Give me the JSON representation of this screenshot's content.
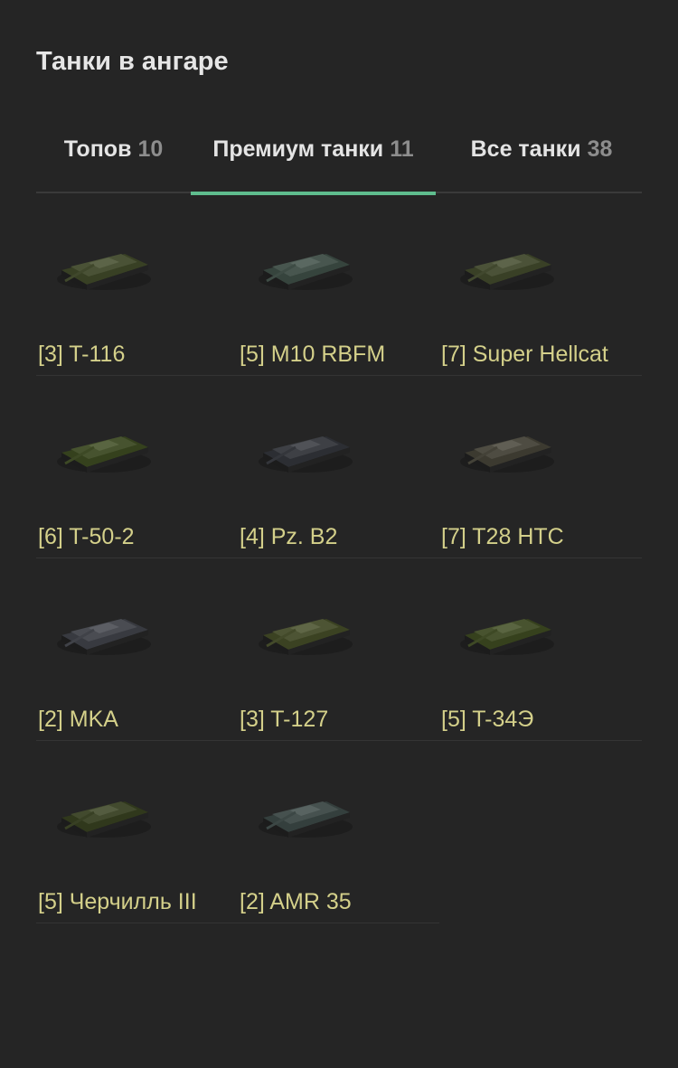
{
  "page": {
    "title": "Танки в ангаре"
  },
  "tabs": [
    {
      "label": "Топов",
      "count": "10"
    },
    {
      "label": "Премиум танки",
      "count": "11"
    },
    {
      "label": "Все танки",
      "count": "38"
    }
  ],
  "tanks": [
    {
      "label": "[3] T-116",
      "tank_color": "#4a5236"
    },
    {
      "label": "[5] M10 RBFM",
      "tank_color": "#48564f"
    },
    {
      "label": "[7] Super Hellcat",
      "tank_color": "#4b5238"
    },
    {
      "label": "[6] T-50-2",
      "tank_color": "#47532f"
    },
    {
      "label": "[4] Pz. B2",
      "tank_color": "#3e4045"
    },
    {
      "label": "[7] T28 HTC",
      "tank_color": "#4e4c42"
    },
    {
      "label": "[2] MKA",
      "tank_color": "#4a4c52"
    },
    {
      "label": "[3] T-127",
      "tank_color": "#4d5434"
    },
    {
      "label": "[5] T-34Э",
      "tank_color": "#48532f"
    },
    {
      "label": "[5] Черчилль III",
      "tank_color": "#424a2e"
    },
    {
      "label": "[2] AMR 35",
      "tank_color": "#46514f"
    }
  ],
  "colors": {
    "accent_underline": "#5fbd8e",
    "tank_name": "#d4d08a",
    "count": "#8d8d8d"
  }
}
